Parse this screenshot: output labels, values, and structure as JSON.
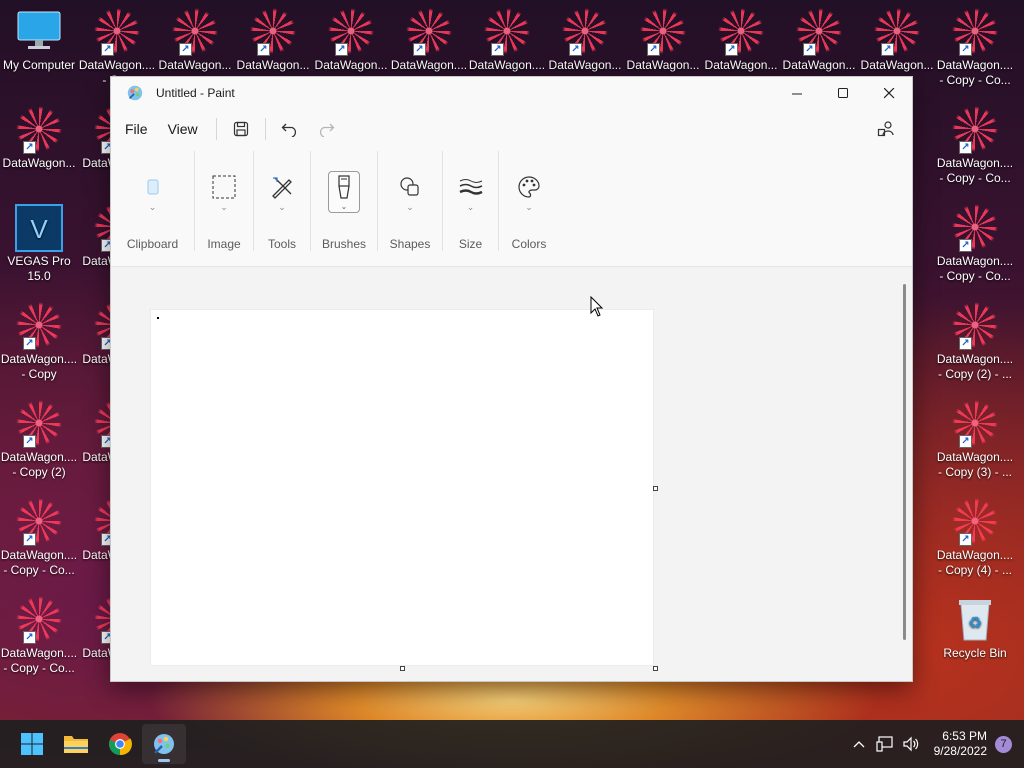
{
  "desktop": {
    "row1": [
      {
        "label": "My Computer",
        "kind": "computer"
      },
      {
        "label": "DataWagon.... - Cop",
        "kind": "shortcut"
      },
      {
        "label": "DataWagon...",
        "kind": "shortcut"
      },
      {
        "label": "DataWagon...",
        "kind": "shortcut"
      },
      {
        "label": "DataWagon...",
        "kind": "shortcut"
      },
      {
        "label": "DataWagon....",
        "kind": "shortcut"
      },
      {
        "label": "DataWagon....",
        "kind": "shortcut"
      },
      {
        "label": "DataWagon...",
        "kind": "shortcut"
      },
      {
        "label": "DataWagon...",
        "kind": "shortcut"
      },
      {
        "label": "DataWagon...",
        "kind": "shortcut"
      },
      {
        "label": "DataWagon...",
        "kind": "shortcut"
      },
      {
        "label": "DataWagon.... - Copy - Co...",
        "kind": "shortcut"
      }
    ],
    "col1": [
      {
        "label": "DataWagon...",
        "kind": "shortcut"
      },
      {
        "label": "VEGAS Pro 15.0",
        "kind": "vegas"
      },
      {
        "label": "DataWagon.... - Copy",
        "kind": "shortcut"
      },
      {
        "label": "DataWagon.... - Copy (2)",
        "kind": "shortcut"
      },
      {
        "label": "DataWagon.... - Copy - Co...",
        "kind": "shortcut"
      },
      {
        "label": "DataWagon.... - Copy - Co...",
        "kind": "shortcut"
      }
    ],
    "col2": [
      {
        "label": "DataW - Cop",
        "kind": "shortcut"
      },
      {
        "label": "DataW - Cop",
        "kind": "shortcut"
      },
      {
        "label": "DataW - Cop",
        "kind": "shortcut"
      },
      {
        "label": "DataW - Cop",
        "kind": "shortcut"
      },
      {
        "label": "DataW - Cop",
        "kind": "shortcut"
      },
      {
        "label": "DataW - Cop",
        "kind": "shortcut"
      }
    ],
    "right_col": [
      {
        "label": "DataWagon.... - Copy - Co...",
        "kind": "shortcut"
      },
      {
        "label": "DataWagon.... - Copy - Co...",
        "kind": "shortcut"
      },
      {
        "label": "DataWagon.... - Copy (2) - ...",
        "kind": "shortcut"
      },
      {
        "label": "DataWagon.... - Copy (3) - ...",
        "kind": "shortcut"
      },
      {
        "label": "DataWagon.... - Copy (4) - ...",
        "kind": "shortcut"
      },
      {
        "label": "Recycle Bin",
        "kind": "recycle"
      }
    ],
    "peek_left_labels": [
      "...",
      "Co...",
      "Co...",
      "Co...",
      "Co...",
      "Co...",
      "Co..."
    ],
    "peek_right_labels": [
      "D",
      "D",
      "D",
      "D",
      "D",
      "D",
      "D"
    ]
  },
  "window": {
    "title": "Untitled - Paint",
    "controls": {
      "minimize": "—",
      "maximize": "▢",
      "close": "✕"
    }
  },
  "menu": {
    "file": "File",
    "view": "View"
  },
  "ribbon": {
    "groups": [
      "Clipboard",
      "Image",
      "Tools",
      "Brushes",
      "Shapes",
      "Size",
      "Colors"
    ]
  },
  "taskbar": {
    "time": "6:53 PM",
    "date": "9/28/2022",
    "notification_count": "7"
  },
  "colors": {
    "accent": "#0067c0",
    "taskbar_bg": "#202020",
    "canvas_bg": "#ffffff"
  }
}
